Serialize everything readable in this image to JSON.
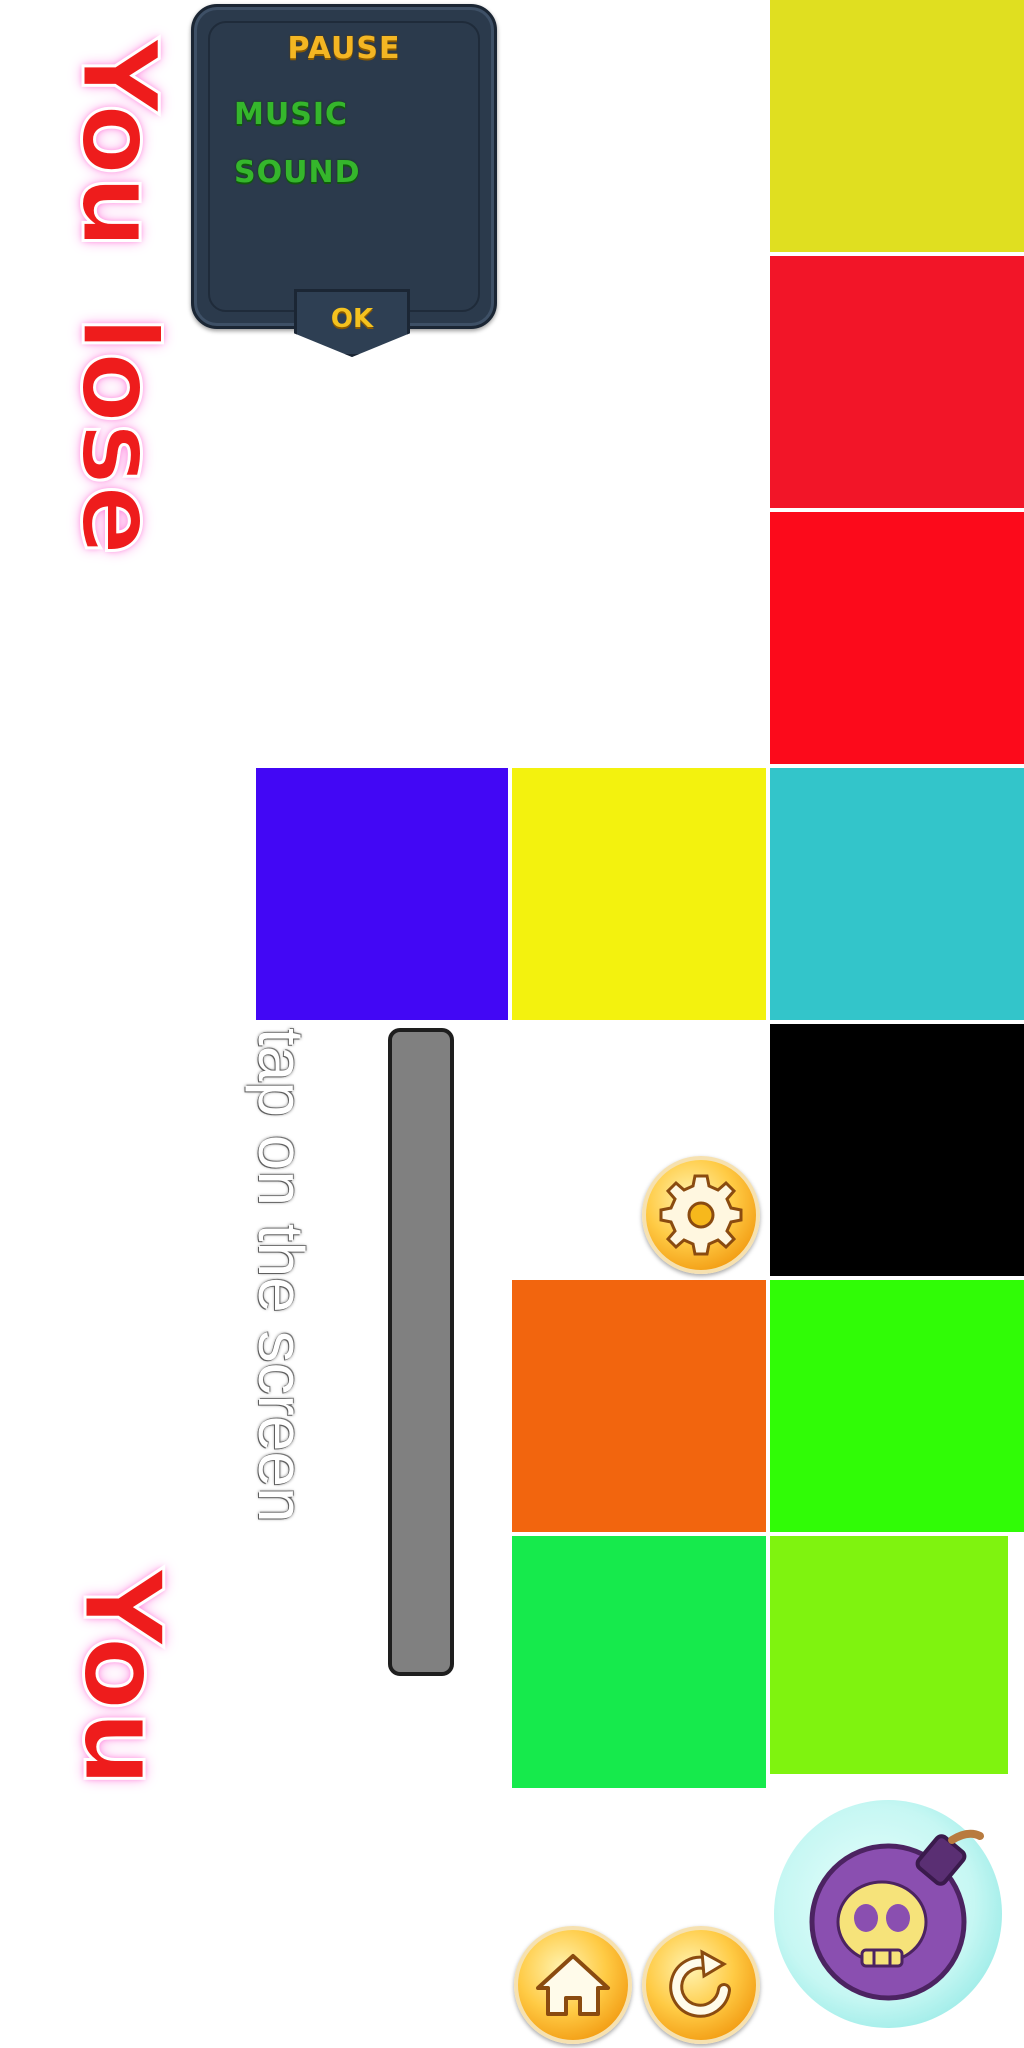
{
  "pause_menu": {
    "title": "PAUSE",
    "music_label": "MUSIC",
    "sound_label": "SOUND",
    "ok_label": "OK"
  },
  "messages": {
    "you_top": "You",
    "lose": "lose",
    "you_bottom": "You",
    "tap_hint": "tap on the screen"
  },
  "tiles": [
    {
      "name": "yellow-tile-top",
      "color": "#e0df20"
    },
    {
      "name": "red-tile-1",
      "color": "#f21528"
    },
    {
      "name": "red-tile-2",
      "color": "#fc0a1b"
    },
    {
      "name": "blue-tile",
      "color": "#4207f5"
    },
    {
      "name": "yellow-tile",
      "color": "#f3f20e"
    },
    {
      "name": "cyan-tile",
      "color": "#33c5ca"
    },
    {
      "name": "black-tile",
      "color": "#000000"
    },
    {
      "name": "orange-tile",
      "color": "#f2650e"
    },
    {
      "name": "green-tile",
      "color": "#30fc06"
    },
    {
      "name": "emerald-tile",
      "color": "#16ea4c"
    },
    {
      "name": "lime-tile",
      "color": "#7ff30f"
    }
  ],
  "icons": {
    "settings": "gear-icon",
    "home": "home-icon",
    "replay": "replay-icon",
    "bomb": "skull-bomb-icon"
  },
  "colors": {
    "progress_bar": "#808080",
    "panel": "#2b3a4c",
    "title_gold": "#f4b623",
    "label_green": "#35b62c",
    "lose_red": "#ee1c1c"
  }
}
